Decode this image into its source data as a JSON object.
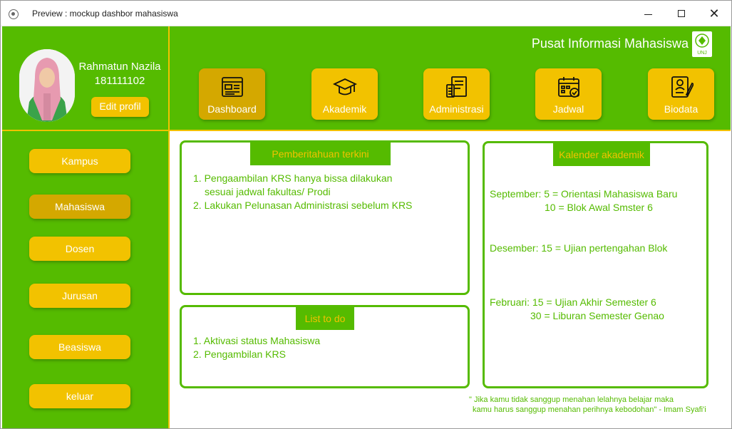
{
  "window": {
    "title": "Preview : mockup dashbor mahasiswa"
  },
  "profile": {
    "name": "Rahmatun Nazila",
    "nim": "181111102",
    "edit_label": "Edit profil"
  },
  "sidebar": {
    "items": [
      {
        "label": "Kampus",
        "active": false
      },
      {
        "label": "Mahasiswa",
        "active": true
      },
      {
        "label": "Dosen",
        "active": false
      },
      {
        "label": "Jurusan",
        "active": false
      },
      {
        "label": "Beasiswa",
        "active": false
      },
      {
        "label": "keluar",
        "active": false
      }
    ]
  },
  "header": {
    "title": "Pusat Informasi Mahasiswa",
    "logo_text": "UNJ",
    "nav": [
      {
        "label": "Dashboard",
        "icon": "dashboard-icon",
        "active": true
      },
      {
        "label": "Akademik",
        "icon": "graduation-cap-icon",
        "active": false
      },
      {
        "label": "Administrasi",
        "icon": "administration-icon",
        "active": false
      },
      {
        "label": "Jadwal",
        "icon": "calendar-check-icon",
        "active": false
      },
      {
        "label": "Biodata",
        "icon": "biodata-icon",
        "active": false
      }
    ]
  },
  "notifications": {
    "title": "Pemberitahuan terkini",
    "lines": [
      "1. Pengaambilan KRS hanya bissa dilakukan",
      "    sesuai jadwal fakultas/ Prodi",
      "2. Lakukan Pelunasan Administrasi sebelum KRS"
    ]
  },
  "todo": {
    "title": "List to do",
    "lines": [
      "1. Aktivasi status Mahasiswa",
      "2. Pengambilan KRS"
    ]
  },
  "calendar": {
    "title": "Kalender akademik",
    "lines": [
      "September: 5 = Orientasi Mahasiswa Baru",
      "10 = Blok Awal Smster 6",
      "Desember: 15 = Ujian pertengahan Blok",
      "Februari: 15 = Ujian Akhir Semester 6",
      "30 = Liburan Semester Genao"
    ]
  },
  "quote": {
    "line1": "\" Jika kamu tidak sanggup menahan lelahnya belajar maka",
    "line2": "kamu harus sanggup menahan perihnya kebodohan\" - Imam Syafi'i"
  },
  "colors": {
    "green": "#55bb00",
    "yellow": "#f2c200",
    "yellow_active": "#d4a800"
  }
}
